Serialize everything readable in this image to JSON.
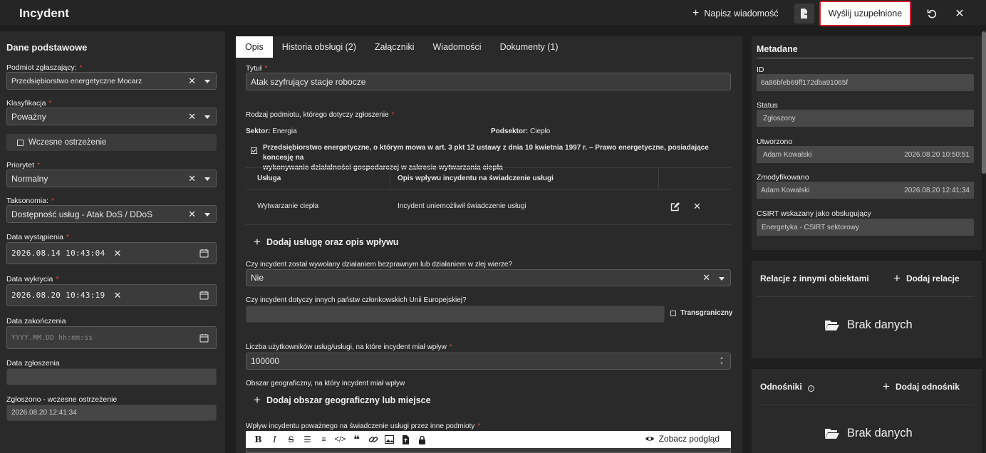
{
  "header": {
    "title": "Incydent",
    "write_message": "Napisz wiadomość",
    "send_label": "Wyślij uzupełnione"
  },
  "left": {
    "section_title": "Dane podstawowe",
    "reporter_label": "Podmiot zgłaszający:",
    "reporter_value": "Przedsiębiorstwo energetyczne Mocarz",
    "classification_label": "Klasyfikacja",
    "classification_value": "Poważny",
    "early_warning_label": "Wczesne ostrzeżenie",
    "priority_label": "Priorytet",
    "priority_value": "Normalny",
    "taxonomy_label": "Taksonomia:",
    "taxonomy_value": "Dostępność usług - Atak DoS / DDoS",
    "occurred_label": "Data wystąpienia",
    "occurred_value": "2026.08.14 10:43:04",
    "detected_label": "Data wykrycia",
    "detected_value": "2026.08.20 10:43:19",
    "ended_label": "Data zakończenia",
    "ended_placeholder": "YYYY.MM.DD hh:mm:ss",
    "reported_label": "Data zgłoszenia",
    "reported_value": "",
    "early_reported_label": "Zgłoszono - wczesne ostrzeżenie",
    "early_reported_value": "2026.08.20 12:41:34"
  },
  "tabs": [
    "Opis",
    "Historia obsługi (2)",
    "Załączniki",
    "Wiadomości",
    "Dokumenty (1)"
  ],
  "center": {
    "title_label": "Tytuł",
    "title_value": "Atak szyfrujący stacje robocze",
    "entity_kind_label": "Rodzaj podmiotu, którego dotyczy zgłoszenie",
    "sector_label": "Sektor:",
    "sector_value": "Energia",
    "subsector_label": "Podsektor:",
    "subsector_value": "Ciepło",
    "entity_desc_line1": "Przedsiębiorstwo energetyczne, o którym mowa w art. 3 pkt 12 ustawy z dnia 10 kwietnia 1997 r. – Prawo energetyczne, posiadające koncesję na",
    "entity_desc_line2": "wykonywanie działalności gospodarczej w zakresie wytwarzania ciepła",
    "table_headers": [
      "Usługa",
      "Opis wpływu incydentu na świadczenie usługi"
    ],
    "table_rows": [
      {
        "service": "Wytwarzanie ciepła",
        "impact": "Incydent uniemożliwił świadczenie usługi"
      }
    ],
    "add_service": "Dodaj usługę oraz opis wpływu",
    "unlawful_label": "Czy incydent został wywołany działaniem bezprawnym lub działaniem w złej wierze?",
    "unlawful_value": "Nie",
    "other_states_label": "Czy incydent dotyczy innych państw członkowskich Unii Europejskiej?",
    "other_states_value": "",
    "crossborder_label": "Transgraniczny",
    "users_count_label": "Liczba użytkowników usług/usługi, na które incydent miał wpływ",
    "users_count_value": "100000",
    "geo_label": "Obszar geograficzny, na który incydent miał wpływ",
    "add_geo": "Dodaj obszar geograficzny lub miejsce",
    "impact_others_label": "Wpływ incydentu poważnego na świadczenie usługi przez inne podmioty",
    "preview_label": "Zobacz podgląd"
  },
  "meta": {
    "title": "Metadane",
    "id_label": "ID",
    "id_value": "6a86bfeb69ff172dba91065f",
    "status_label": "Status",
    "status_value": "Zgłoszony",
    "created_label": "Utworzono",
    "created_by": "Adam Kowalski",
    "created_at": "2026.08.20 10:50:51",
    "modified_label": "Zmodyfikowano",
    "modified_by": "Adam Kowalski",
    "modified_at": "2026.08.20 12:41:34",
    "csirt_label": "CSIRT wskazany jako obsługujący",
    "csirt_value": "Energetyka - CSIRT sektorowy"
  },
  "relations": {
    "title": "Relacje z innymi obiektami",
    "add_label": "Dodaj relacje",
    "empty_text": "Brak danych"
  },
  "references": {
    "title": "Odnośniki",
    "add_label": "Dodaj odnośnik",
    "empty_text": "Brak danych"
  },
  "colors": {
    "background": "#1e1e1e",
    "panel": "#2a2a2a",
    "field": "#3b3b3b",
    "required": "#e0424a",
    "send_border": "#d11f2a"
  }
}
